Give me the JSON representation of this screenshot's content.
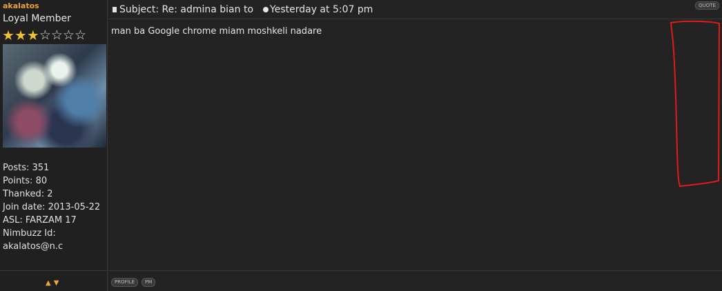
{
  "user": {
    "name": "akalatos",
    "rank": "Loyal Member",
    "stars_on": 3,
    "stars_total": 7
  },
  "stats": {
    "posts": "Posts: 351",
    "points": "Points: 80",
    "thanked": "Thanked: 2",
    "join": "Join date: 2013-05-22",
    "asl": "ASL: FARZAM 17",
    "nimbuzz": "Nimbuzz Id:",
    "nimbuzz_value": "akalatos@n.c"
  },
  "post": {
    "subject": "Subject: Re: admina bian to",
    "time": "Yesterday at 5:07 pm",
    "message": "man ba Google chrome miam moshkeli nadare",
    "quote_label": "QUOTE"
  },
  "footer": {
    "profile_label": "PROFILE",
    "pm_label": "PM"
  },
  "colors": {
    "username": "#e9a33a",
    "annotation": "#e01b1b",
    "star_on": "#f2c12e"
  }
}
